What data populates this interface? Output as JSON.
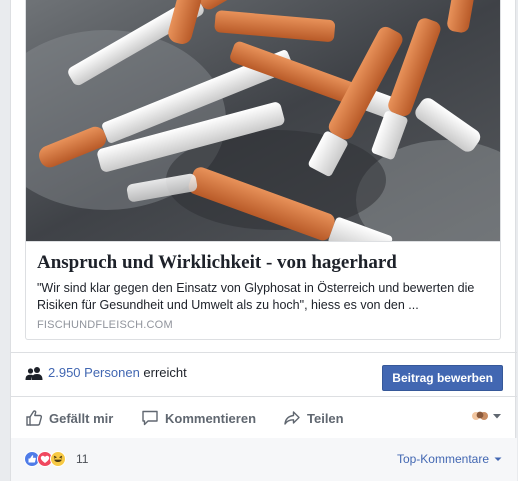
{
  "link_preview": {
    "title": "Anspruch und Wirklichkeit - von hagerhard",
    "description": "\"Wir sind klar gegen den Einsatz von Glyphosat in Österreich und bewerten die Risiken für Gesundheit und Umwelt als zu hoch\", hiess es von den ...",
    "domain": "FISCHUNDFLEISCH.COM",
    "image_icon": "cigarette-butts-photo"
  },
  "reach": {
    "count": "2.950 Personen",
    "suffix": "erreicht",
    "icon": "people-icon",
    "boost_label": "Beitrag bewerben"
  },
  "actions": {
    "like_label": "Gefällt mir",
    "comment_label": "Kommentieren",
    "share_label": "Teilen"
  },
  "reactions": {
    "icons": [
      "like-reaction-icon",
      "love-reaction-icon",
      "haha-reaction-icon"
    ],
    "count": "11",
    "sort_label": "Top-Kommentare"
  },
  "colors": {
    "accent": "#4267b2",
    "background": "#e9ebee",
    "muted_text": "#90949c"
  }
}
